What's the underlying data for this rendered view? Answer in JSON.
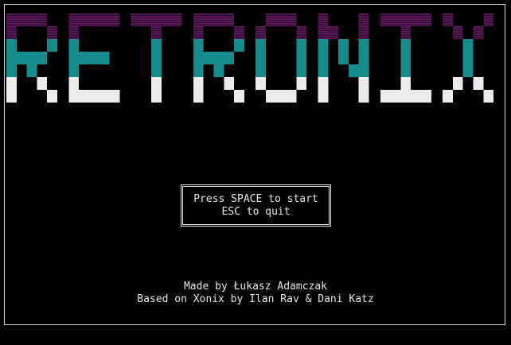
{
  "game": {
    "title_logo": "RETRONIX",
    "menu": {
      "start_prompt": "Press SPACE to start",
      "quit_prompt": "ESC to quit"
    },
    "credits": {
      "author": "Made by Łukasz Adamczak",
      "based_on": "Based on Xonix by Ilan Rav & Dani Katz"
    }
  },
  "colors": {
    "background": "#000000",
    "text": "#e6e6e6",
    "logo_top": "#5a1858",
    "logo_middle": "#148c8c",
    "logo_bottom": "#ececec"
  }
}
